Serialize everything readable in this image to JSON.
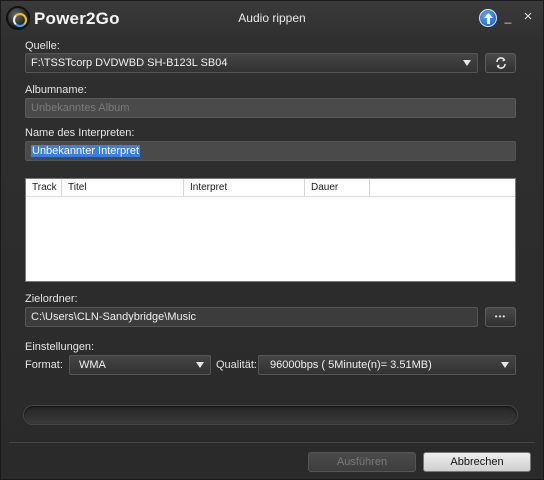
{
  "app": {
    "name": "Power2Go",
    "window_title": "Audio rippen"
  },
  "titlebar": {
    "update_icon": "up-arrow-icon",
    "minimize_glyph": "_",
    "close_glyph": "×"
  },
  "source": {
    "label": "Quelle:",
    "value": "F:\\TSSTcorp DVDWBD SH-B123L SB04",
    "refresh_icon": "refresh-icon"
  },
  "album": {
    "label": "Albumname:",
    "value": "Unbekanntes Album"
  },
  "artist": {
    "label": "Name des Interpreten:",
    "value": "Unbekannter Interpret"
  },
  "tracks": {
    "columns": [
      "Track",
      "Titel",
      "Interpret",
      "Dauer"
    ],
    "rows": []
  },
  "destination": {
    "label": "Zielordner:",
    "value": "C:\\Users\\CLN-Sandybridge\\Music",
    "browse_label": "•••"
  },
  "settings": {
    "label": "Einstellungen:",
    "format_label": "Format:",
    "format_value": "WMA",
    "quality_label": "Qualität:",
    "quality_value": "96000bps ( 5Minute(n)= 3.51MB)"
  },
  "progress": {
    "percent": 0
  },
  "buttons": {
    "run": "Ausführen",
    "cancel": "Abbrechen"
  },
  "colors": {
    "selection": "#3b7fe0",
    "accent_blue": "#1a6fe0"
  }
}
